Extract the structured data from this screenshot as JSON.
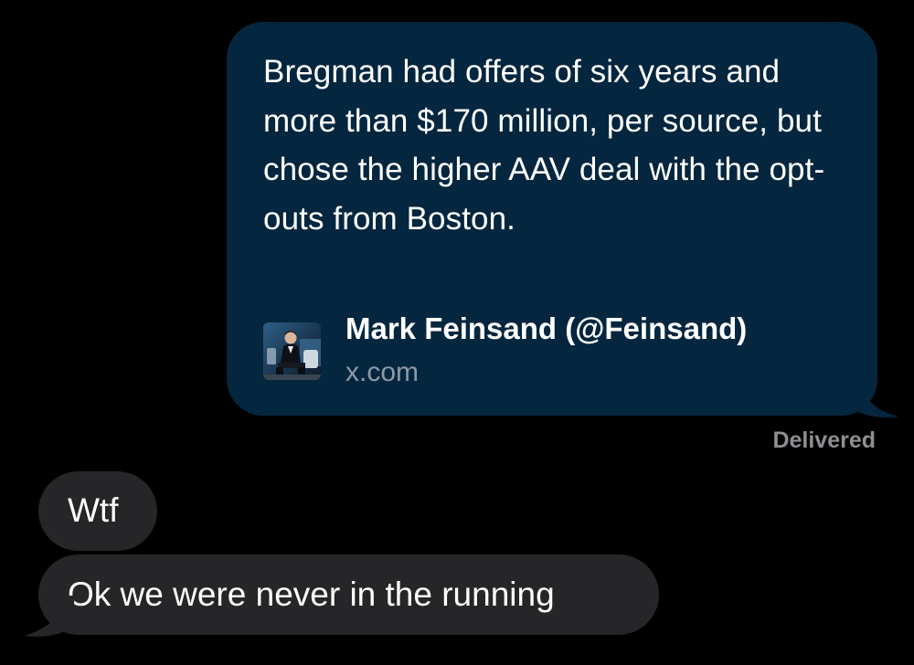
{
  "conversation": {
    "sent_message": {
      "text": "Bregman had offers of six years and more than $170 million, per source, but chose the higher AAV deal with the opt-outs from Boston.",
      "link_preview": {
        "title": "Mark Feinsand (@Feinsand)",
        "domain": "x.com",
        "thumbnail_icon": "person-seated-photo"
      },
      "bubble_color": "#05263f"
    },
    "status": "Delivered",
    "received_messages": [
      {
        "text": "Wtf"
      },
      {
        "text": "Ok we were never in the running"
      }
    ],
    "received_bubble_color": "#262628"
  }
}
